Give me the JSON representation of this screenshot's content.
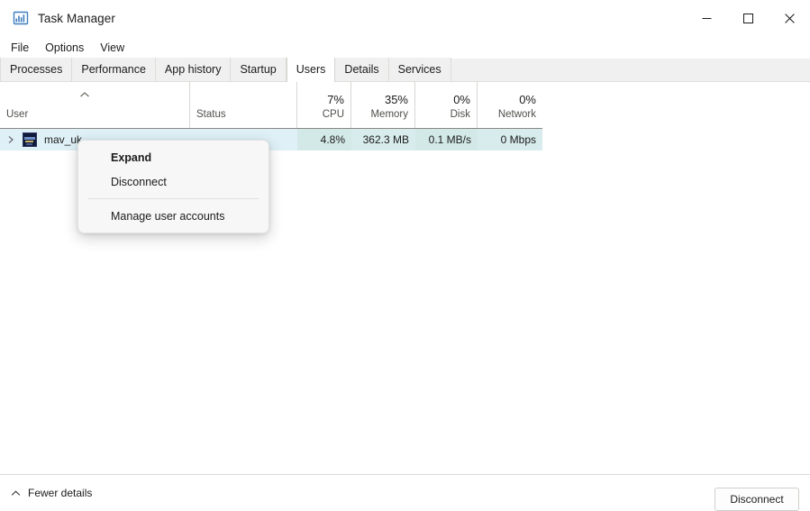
{
  "window": {
    "title": "Task Manager",
    "icon": "task-manager-icon",
    "controls": {
      "minimize": "–",
      "maximize": "□",
      "close": "✕"
    }
  },
  "menubar": {
    "items": [
      {
        "label": "File"
      },
      {
        "label": "Options"
      },
      {
        "label": "View"
      }
    ]
  },
  "tabs": [
    {
      "label": "Processes",
      "active": false
    },
    {
      "label": "Performance",
      "active": false
    },
    {
      "label": "App history",
      "active": false
    },
    {
      "label": "Startup",
      "active": false
    },
    {
      "label": "Users",
      "active": true
    },
    {
      "label": "Details",
      "active": false
    },
    {
      "label": "Services",
      "active": false
    }
  ],
  "table": {
    "sort": {
      "column": "User",
      "direction": "ascending"
    },
    "columns": [
      {
        "key": "user",
        "top": "",
        "label": "User",
        "align": "left"
      },
      {
        "key": "status",
        "top": "",
        "label": "Status",
        "align": "left"
      },
      {
        "key": "cpu",
        "top": "7%",
        "label": "CPU",
        "align": "right"
      },
      {
        "key": "memory",
        "top": "35%",
        "label": "Memory",
        "align": "right"
      },
      {
        "key": "disk",
        "top": "0%",
        "label": "Disk",
        "align": "right"
      },
      {
        "key": "network",
        "top": "0%",
        "label": "Network",
        "align": "right"
      }
    ],
    "rows": [
      {
        "user": "mav_uk",
        "status": "",
        "cpu": "4.8%",
        "memory": "362.3 MB",
        "disk": "0.1 MB/s",
        "network": "0 Mbps",
        "selected": true,
        "expanded": false
      }
    ]
  },
  "context_menu": {
    "items": [
      {
        "label": "Expand",
        "bold": true,
        "separator_after": false
      },
      {
        "label": "Disconnect",
        "bold": false,
        "separator_after": true
      },
      {
        "label": "Manage user accounts",
        "bold": false,
        "separator_after": false
      }
    ]
  },
  "bottom_bar": {
    "fewer_details": "Fewer details",
    "disconnect_button": "Disconnect"
  },
  "colors": {
    "selection": "#dff0f7",
    "tab_strip": "#f0f0f0",
    "menu_bg": "#f7f7f7",
    "header_rule": "#888884",
    "text": "#1b1b1b",
    "muted_text": "#50504c"
  }
}
